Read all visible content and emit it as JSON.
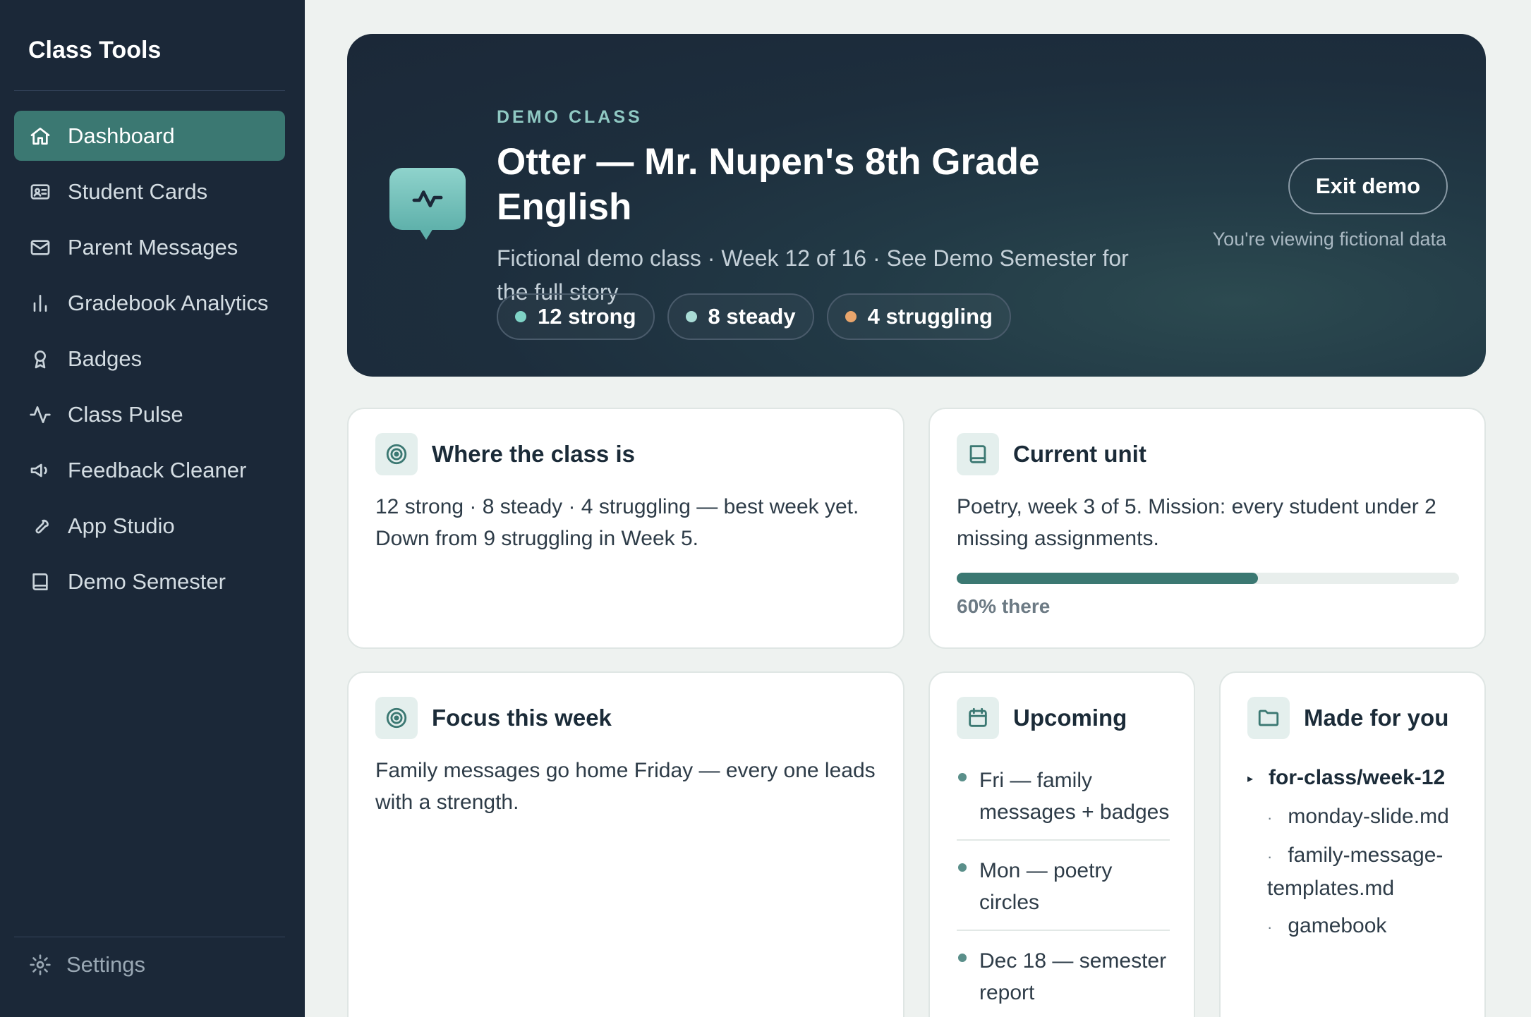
{
  "sidebar": {
    "brand": "Class Tools",
    "items": [
      {
        "label": "Dashboard",
        "icon": "home-icon",
        "active": true
      },
      {
        "label": "Student Cards",
        "icon": "id-card-icon"
      },
      {
        "label": "Parent Messages",
        "icon": "mail-icon"
      },
      {
        "label": "Gradebook Analytics",
        "icon": "bar-chart-icon"
      },
      {
        "label": "Badges",
        "icon": "award-icon"
      },
      {
        "label": "Class Pulse",
        "icon": "activity-icon"
      },
      {
        "label": "Feedback Cleaner",
        "icon": "megaphone-icon"
      },
      {
        "label": "App Studio",
        "icon": "wrench-icon"
      },
      {
        "label": "Demo Semester",
        "icon": "book-icon"
      }
    ],
    "settings_label": "Settings"
  },
  "hero": {
    "eyebrow": "DEMO CLASS",
    "title": "Otter — Mr. Nupen's 8th Grade English",
    "subtitle": "Fictional demo class · Week 12 of 16 · See Demo Semester for the full story",
    "pills": [
      {
        "label": "12 strong",
        "color": "#7fd3c6"
      },
      {
        "label": "8 steady",
        "color": "#a9dcd6"
      },
      {
        "label": "4 struggling",
        "color": "#e8a56c"
      }
    ],
    "exit_label": "Exit demo",
    "viewing_note": "You're viewing fictional data"
  },
  "cards": {
    "where": {
      "title": "Where the class is",
      "body": "12 strong · 8 steady · 4 struggling — best week yet. Down from 9 struggling in Week 5."
    },
    "unit": {
      "title": "Current unit",
      "body": "Poetry, week 3 of 5. Mission: every student under 2 missing assignments.",
      "progress": 0.6,
      "progress_label": "60% there"
    },
    "focus": {
      "title": "Focus this week",
      "body": "Family messages go home Friday — every one leads with a strength."
    },
    "upcoming": {
      "title": "Upcoming",
      "items": [
        "Fri — family messages + badges",
        "Mon — poetry circles",
        "Dec 18 — semester report"
      ]
    },
    "made": {
      "title": "Made for you",
      "folder": "for-class/week-12",
      "files": [
        "monday-slide.md",
        "family-message-templates.md",
        "gamebook"
      ]
    }
  },
  "colors": {
    "accent": "#3b7872",
    "sidebar_bg": "#1b2838",
    "hero_bg": "#1b2838"
  }
}
